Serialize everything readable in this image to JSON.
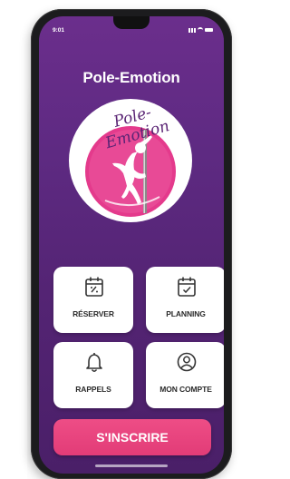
{
  "status_bar": {
    "time": "9:01"
  },
  "app": {
    "title": "Pole-Emotion"
  },
  "logo": {
    "text": "Pole-Emotion",
    "brand_color": "#e43a8c",
    "accent_color": "#5a2474"
  },
  "tiles": [
    {
      "label": "RÉSERVER",
      "icon": "calendar-icon"
    },
    {
      "label": "PLANNING",
      "icon": "calendar-check-icon"
    },
    {
      "label": "RAPPELS",
      "icon": "bell-icon"
    },
    {
      "label": "MON COMPTE",
      "icon": "user-icon"
    }
  ],
  "cta": {
    "label": "S'INSCRIRE",
    "color": "#ec4680"
  },
  "theme": {
    "background": "#5e2a82"
  }
}
